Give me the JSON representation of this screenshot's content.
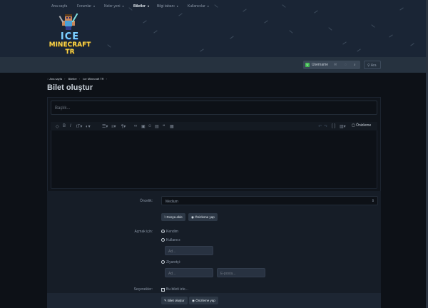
{
  "brand": {
    "line1": "ICE",
    "line2": "MINECRAFT TR"
  },
  "nav": {
    "items": [
      {
        "label": "Ana sayfa",
        "chev": ""
      },
      {
        "label": "Forumlar",
        "chev": "▾"
      },
      {
        "label": "Neler yeni",
        "chev": "▾"
      },
      {
        "label": "Biletler",
        "chev": "▾"
      },
      {
        "label": "Bilgi tabanı",
        "chev": "▾"
      },
      {
        "label": "Kullanıcılar",
        "chev": "▾"
      }
    ],
    "user_label": "Username",
    "user_badge": "U",
    "search_label": "Ara"
  },
  "breadcrumb": [
    "Ana sayfa",
    "Biletler",
    "Ice Minecraft TR"
  ],
  "page_title": "Bilet oluştur",
  "title_input": {
    "placeholder": "Başlık..."
  },
  "editor": {
    "preview_label": "Önizleme"
  },
  "form": {
    "priority_label": "Öncelik:",
    "priority_value": "Medium",
    "attach_label": "Dosya ekle",
    "preview_btn": "Önizleme yap",
    "open_for_label": "Açmak için:",
    "radio_self": "Kendim",
    "radio_user": "Kullanıcı:",
    "radio_guest": "Ziyaretçi:",
    "user_placeholder": "Ad...",
    "guest_name_placeholder": "Ad...",
    "guest_email_placeholder": "E-posta...",
    "options_label": "Seçenekler:",
    "watch_label": "Bu bileti izle...",
    "submit_btn": "Bilet oluştur",
    "submit_preview_btn": "Önizleme yap"
  }
}
